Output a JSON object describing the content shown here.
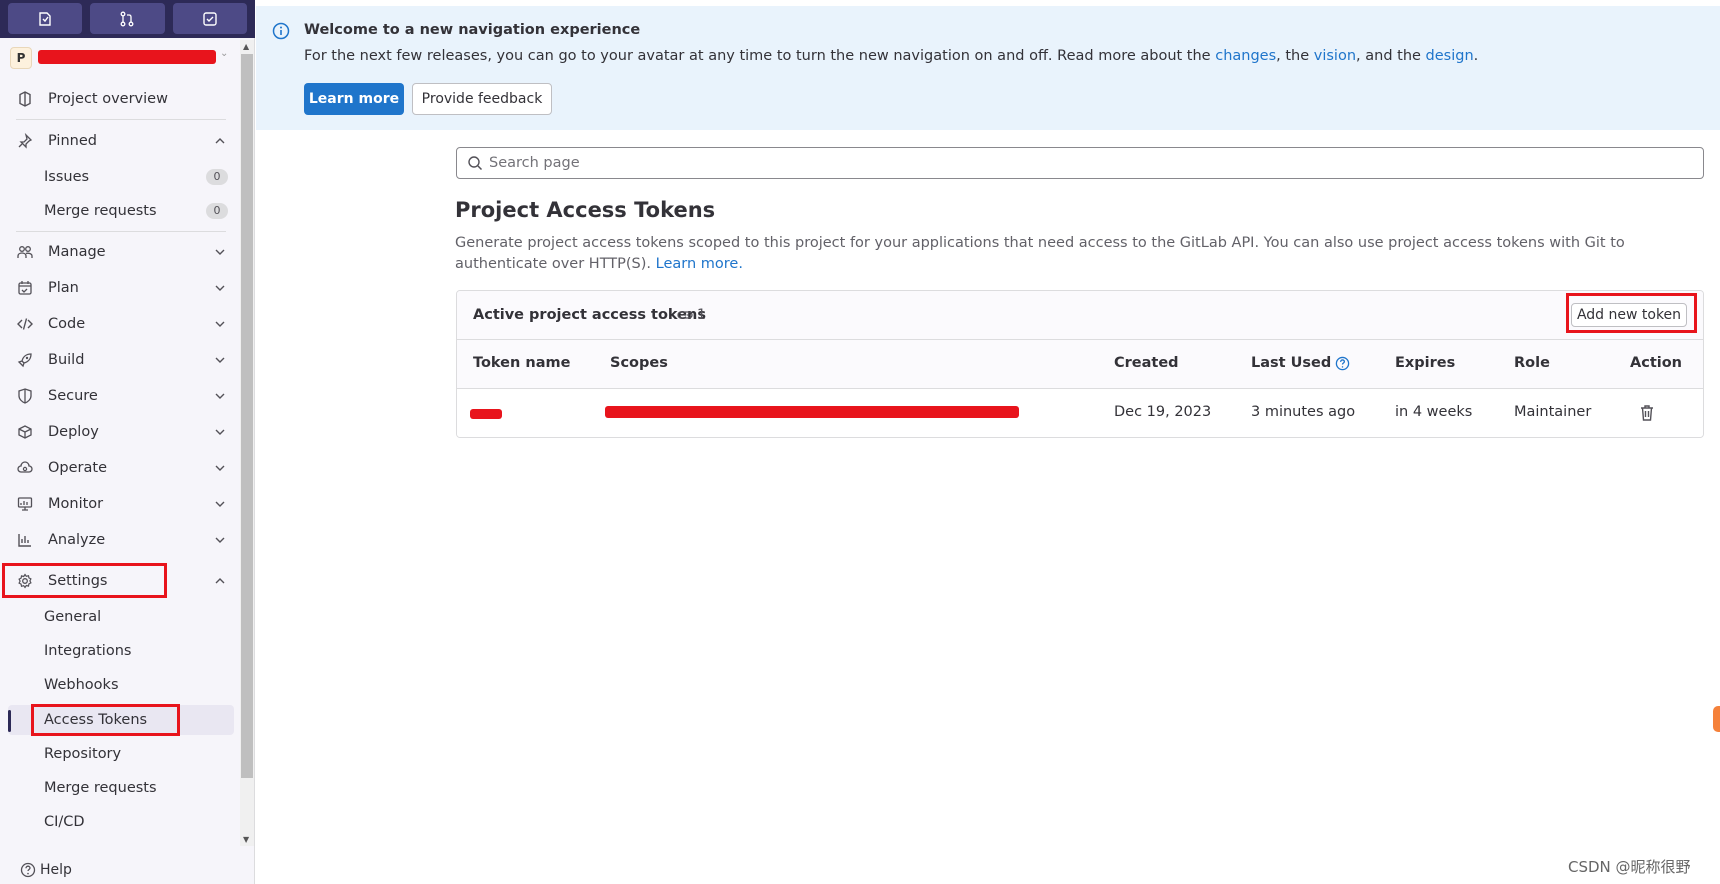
{
  "sidebar": {
    "top_buttons": [
      {
        "name": "issues-icon"
      },
      {
        "name": "merge-request-icon"
      },
      {
        "name": "todo-icon"
      }
    ],
    "project_initial": "P",
    "project_overview": "Project overview",
    "pinned": {
      "label": "Pinned",
      "items": [
        {
          "label": "Issues",
          "count": "0"
        },
        {
          "label": "Merge requests",
          "count": "0"
        }
      ]
    },
    "sections": [
      "Manage",
      "Plan",
      "Code",
      "Build",
      "Secure",
      "Deploy",
      "Operate",
      "Monitor",
      "Analyze"
    ],
    "settings": {
      "label": "Settings",
      "items": [
        "General",
        "Integrations",
        "Webhooks",
        "Access Tokens",
        "Repository",
        "Merge requests",
        "CI/CD"
      ],
      "active": "Access Tokens"
    },
    "help": "Help"
  },
  "banner": {
    "title": "Welcome to a new navigation experience",
    "text_before": "For the next few releases, you can go to your avatar at any time to turn the new navigation on and off. Read more about the ",
    "link_changes": "changes",
    "sep1": ", the ",
    "link_vision": "vision",
    "sep2": ", and the ",
    "link_design": "design",
    "text_end": ".",
    "learn_more": "Learn more",
    "feedback": "Provide feedback"
  },
  "search": {
    "placeholder": "Search page"
  },
  "main": {
    "title": "Project Access Tokens",
    "description": "Generate project access tokens scoped to this project for your applications that need access to the GitLab API. You can also use project access tokens with Git to authenticate over HTTP(S). ",
    "description_link": "Learn more."
  },
  "tokens_card": {
    "title": "Active project access tokens",
    "count": "1",
    "add_button": "Add new token",
    "columns": [
      "Token name",
      "Scopes",
      "Created",
      "Last Used",
      "Expires",
      "Role",
      "Action"
    ],
    "rows": [
      {
        "created": "Dec 19, 2023",
        "last_used": "3 minutes ago",
        "expires": "in 4 weeks",
        "role": "Maintainer"
      }
    ]
  },
  "watermark": "CSDN @昵称很野",
  "colors": {
    "accent": "#1f75cb",
    "sidebar_top": "#2d2a57",
    "highlight": "#e8141c",
    "banner_bg": "#e9f3fc"
  }
}
